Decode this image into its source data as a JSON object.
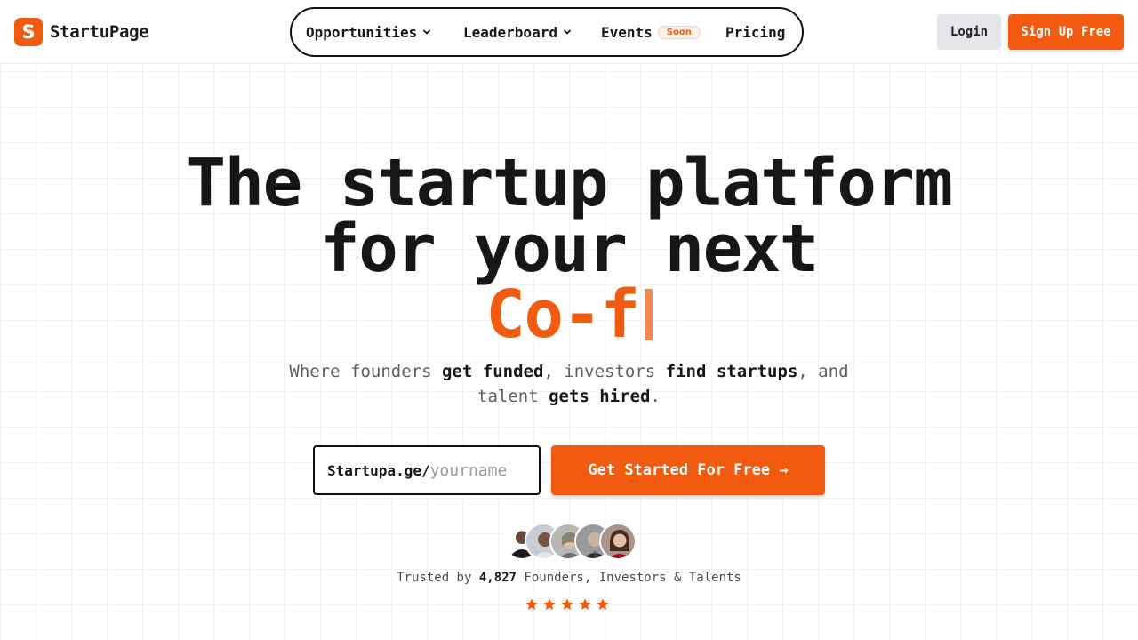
{
  "brand": {
    "name": "StartuPage",
    "accent": "#f25a0f"
  },
  "nav": {
    "items": [
      {
        "label": "Opportunities",
        "has_dropdown": true
      },
      {
        "label": "Leaderboard",
        "has_dropdown": true
      },
      {
        "label": "Events",
        "badge": "Soon"
      },
      {
        "label": "Pricing"
      }
    ]
  },
  "auth": {
    "login_label": "Login",
    "signup_label": "Sign Up Free"
  },
  "hero": {
    "line1": "The startup platform",
    "line2": "for your next",
    "typed_text": "Co-f",
    "subtitle": {
      "part1": "Where founders ",
      "bold1": "get funded",
      "part2": ", investors ",
      "bold2": "find startups",
      "part3": ", and talent ",
      "bold3": "gets hired",
      "part4": "."
    }
  },
  "signup_form": {
    "url_prefix": "Startupa.ge/",
    "placeholder": "yourname",
    "value": "",
    "cta_label": "Get Started For Free →"
  },
  "social_proof": {
    "avatar_count": 5,
    "text_before": "Trusted by ",
    "count": "4,827",
    "text_after": " Founders, Investors & Talents",
    "rating": 5
  }
}
